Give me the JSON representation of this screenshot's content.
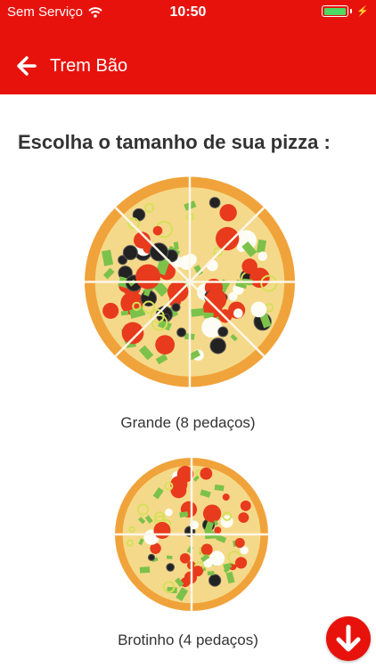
{
  "status_bar": {
    "carrier": "Sem Serviço",
    "time": "10:50",
    "battery_level": 0.95
  },
  "header": {
    "title": "Trem Bão",
    "back_icon": "arrow-left-icon"
  },
  "main": {
    "heading": "Escolha o tamanho de sua pizza :",
    "options": [
      {
        "label": "Grande (8 pedaços)",
        "slices": 8
      },
      {
        "label": "Brotinho (4 pedaços)",
        "slices": 4
      }
    ],
    "scroll_button_icon": "arrow-down-icon"
  },
  "colors": {
    "brand": "#e8120c",
    "text": "#333333",
    "battery": "#4cd964"
  }
}
